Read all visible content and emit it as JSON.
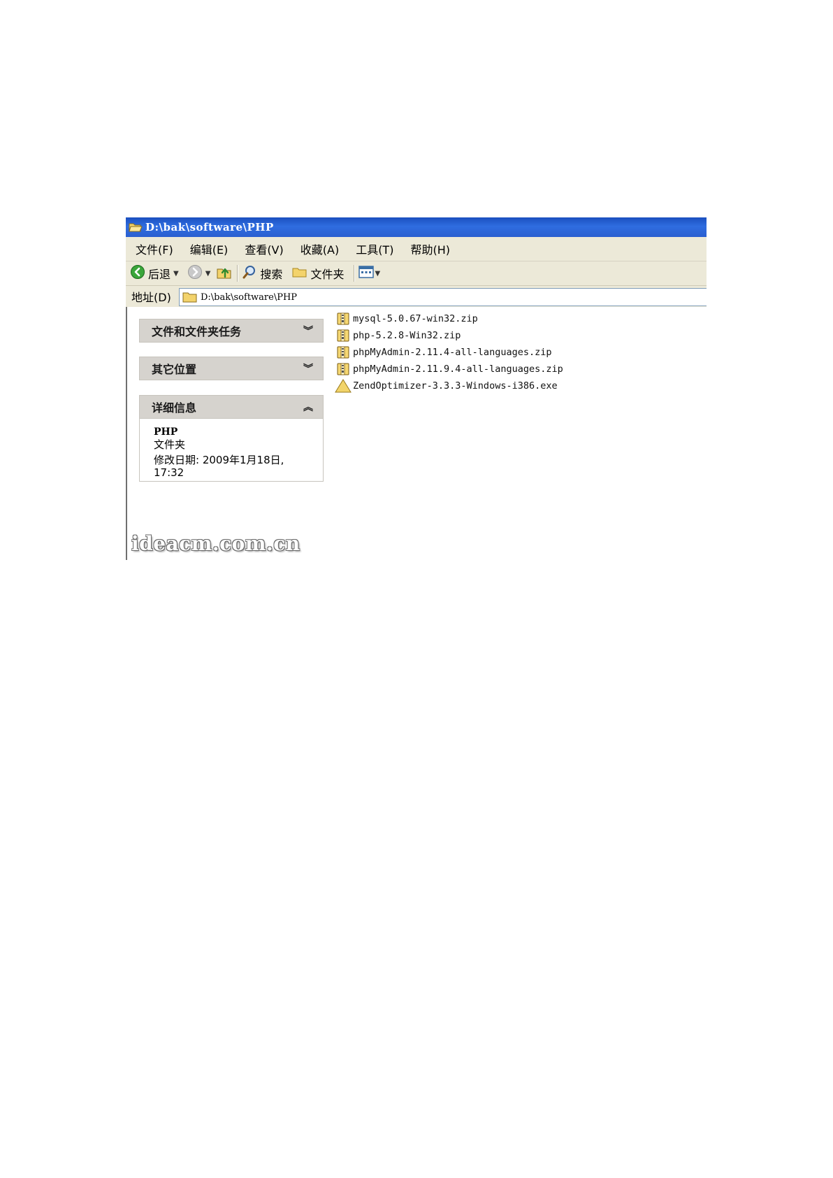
{
  "window": {
    "title": "D:\\bak\\software\\PHP"
  },
  "menu": {
    "items": [
      {
        "label": "文件(F)"
      },
      {
        "label": "编辑(E)"
      },
      {
        "label": "查看(V)"
      },
      {
        "label": "收藏(A)"
      },
      {
        "label": "工具(T)"
      },
      {
        "label": "帮助(H)"
      }
    ]
  },
  "toolbar": {
    "back_label": "后退",
    "search_label": "搜索",
    "folders_label": "文件夹"
  },
  "address": {
    "label": "地址(D)",
    "value": "D:\\bak\\software\\PHP"
  },
  "sidebar": {
    "tasks_title": "文件和文件夹任务",
    "places_title": "其它位置",
    "details_title": "详细信息",
    "details": {
      "name": "PHP",
      "type": "文件夹",
      "modified_line1": "修改日期: 2009年1月18日,",
      "modified_line2": "17:32"
    }
  },
  "files": [
    {
      "name": "mysql-5.0.67-win32.zip",
      "icon": "zip-icon"
    },
    {
      "name": "php-5.2.8-Win32.zip",
      "icon": "zip-icon"
    },
    {
      "name": "phpMyAdmin-2.11.4-all-languages.zip",
      "icon": "zip-icon"
    },
    {
      "name": "phpMyAdmin-2.11.9.4-all-languages.zip",
      "icon": "zip-icon"
    },
    {
      "name": "ZendOptimizer-3.3.3-Windows-i386.exe",
      "icon": "installer-icon"
    }
  ],
  "watermark": "ideacm.com.cn",
  "colors": {
    "titlebar": "#2a5fd0",
    "chrome": "#ece9d8",
    "panel_header": "#d6d3ce"
  }
}
